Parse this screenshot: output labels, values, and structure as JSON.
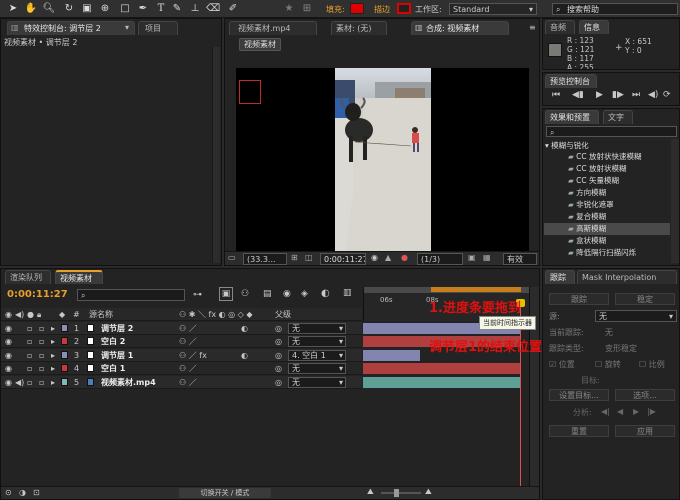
{
  "toolbar": {
    "fill_label": "填充:",
    "stroke_label": "描边",
    "workspace_label": "工作区:",
    "workspace_value": "Standard",
    "search_placeholder": "搜索帮助"
  },
  "left_panel": {
    "tab_effect_controls": "特效控制台: 调节层 2",
    "tab_project": "项目",
    "breadcrumb": "视频素材 • 调节层 2"
  },
  "viewer": {
    "tab_footage": "视频素材.mp4",
    "tab_material": "素材: (无)",
    "tab_comp": "合成: 视频素材",
    "sub_tab": "视频素材",
    "zoom": "(33.3...",
    "timecode": "0:00:11:27",
    "resolution": "(1/3)",
    "active_camera": "有效"
  },
  "info_panel": {
    "tab_audio": "音频",
    "tab_info": "信息",
    "r": "R : 123",
    "g": "G : 121",
    "b": "B : 117",
    "a": "A : 255",
    "x": "X : 651",
    "y": "Y : 0"
  },
  "preview_panel": {
    "title": "预览控制台"
  },
  "effects_panel": {
    "tab_effects": "效果和预置",
    "tab_text": "文字",
    "category": "模糊与锐化",
    "items": [
      "CC 放射状快速模糊",
      "CC 放射状模糊",
      "CC 矢量模糊",
      "方向模糊",
      "非锐化遮罩",
      "复合模糊",
      "高斯模糊",
      "盒状模糊",
      "降低隔行扫描闪烁"
    ],
    "selected_index": 6
  },
  "tracker_panel": {
    "tab_tracker": "跟踪",
    "tab_mask": "Mask Interpolation",
    "btn_track": "跟踪",
    "btn_stabilize": "稳定",
    "source_label": "源:",
    "source_value": "无",
    "current_track_label": "当前跟踪:",
    "current_track_value": "无",
    "type_label": "跟踪类型:",
    "type_value": "变形稳定",
    "opt_position": "位置",
    "opt_rotate": "旋转",
    "opt_scale": "比例",
    "target_label": "目标:",
    "btn_set_target": "设置目标...",
    "btn_options": "选项...",
    "analyze_label": "分析:",
    "btn_reset": "重置",
    "btn_apply": "应用"
  },
  "timeline": {
    "tab_render": "渲染队列",
    "tab_comp": "视频素材",
    "timecode": "0:00:11:27",
    "col_layer_name": "源名称",
    "col_parent": "父级",
    "ruler_06": "06s",
    "ruler_08": "08s",
    "tooltip": "当前时间指示器",
    "bottom_toggle": "切换开关 / 模式",
    "layers": [
      {
        "num": "1",
        "name": "调节层 2",
        "label_color": "#8a8fb8",
        "parent": "无",
        "fx": false,
        "bar_color": "#8285b0",
        "bar_start": 0.0,
        "bar_end": 1.0
      },
      {
        "num": "2",
        "name": "空白 2",
        "label_color": "#c83a3a",
        "parent": "无",
        "fx": false,
        "bar_color": "#b04040",
        "bar_start": 0.0,
        "bar_end": 1.0
      },
      {
        "num": "3",
        "name": "调节层 1",
        "label_color": "#8a8fb8",
        "parent": "4. 空白 1",
        "fx": true,
        "bar_color": "#8285b0",
        "bar_start": 0.0,
        "bar_end": 0.36
      },
      {
        "num": "4",
        "name": "空白 1",
        "label_color": "#c83a3a",
        "parent": "无",
        "fx": false,
        "bar_color": "#b04040",
        "bar_start": 0.0,
        "bar_end": 1.0
      },
      {
        "num": "5",
        "name": "视频素材.mp4",
        "label_color": "#7fb8b0",
        "parent": "无",
        "fx": false,
        "bar_color": "#5fa096",
        "bar_start": 0.0,
        "bar_end": 1.0
      }
    ]
  },
  "annotations": {
    "line1": "1.进度条要拖到",
    "line2": "调节层1的结束位置上",
    "color": "#e01010"
  },
  "colors": {
    "accent_orange": "#e8a02a",
    "fill_red": "#e00000"
  }
}
